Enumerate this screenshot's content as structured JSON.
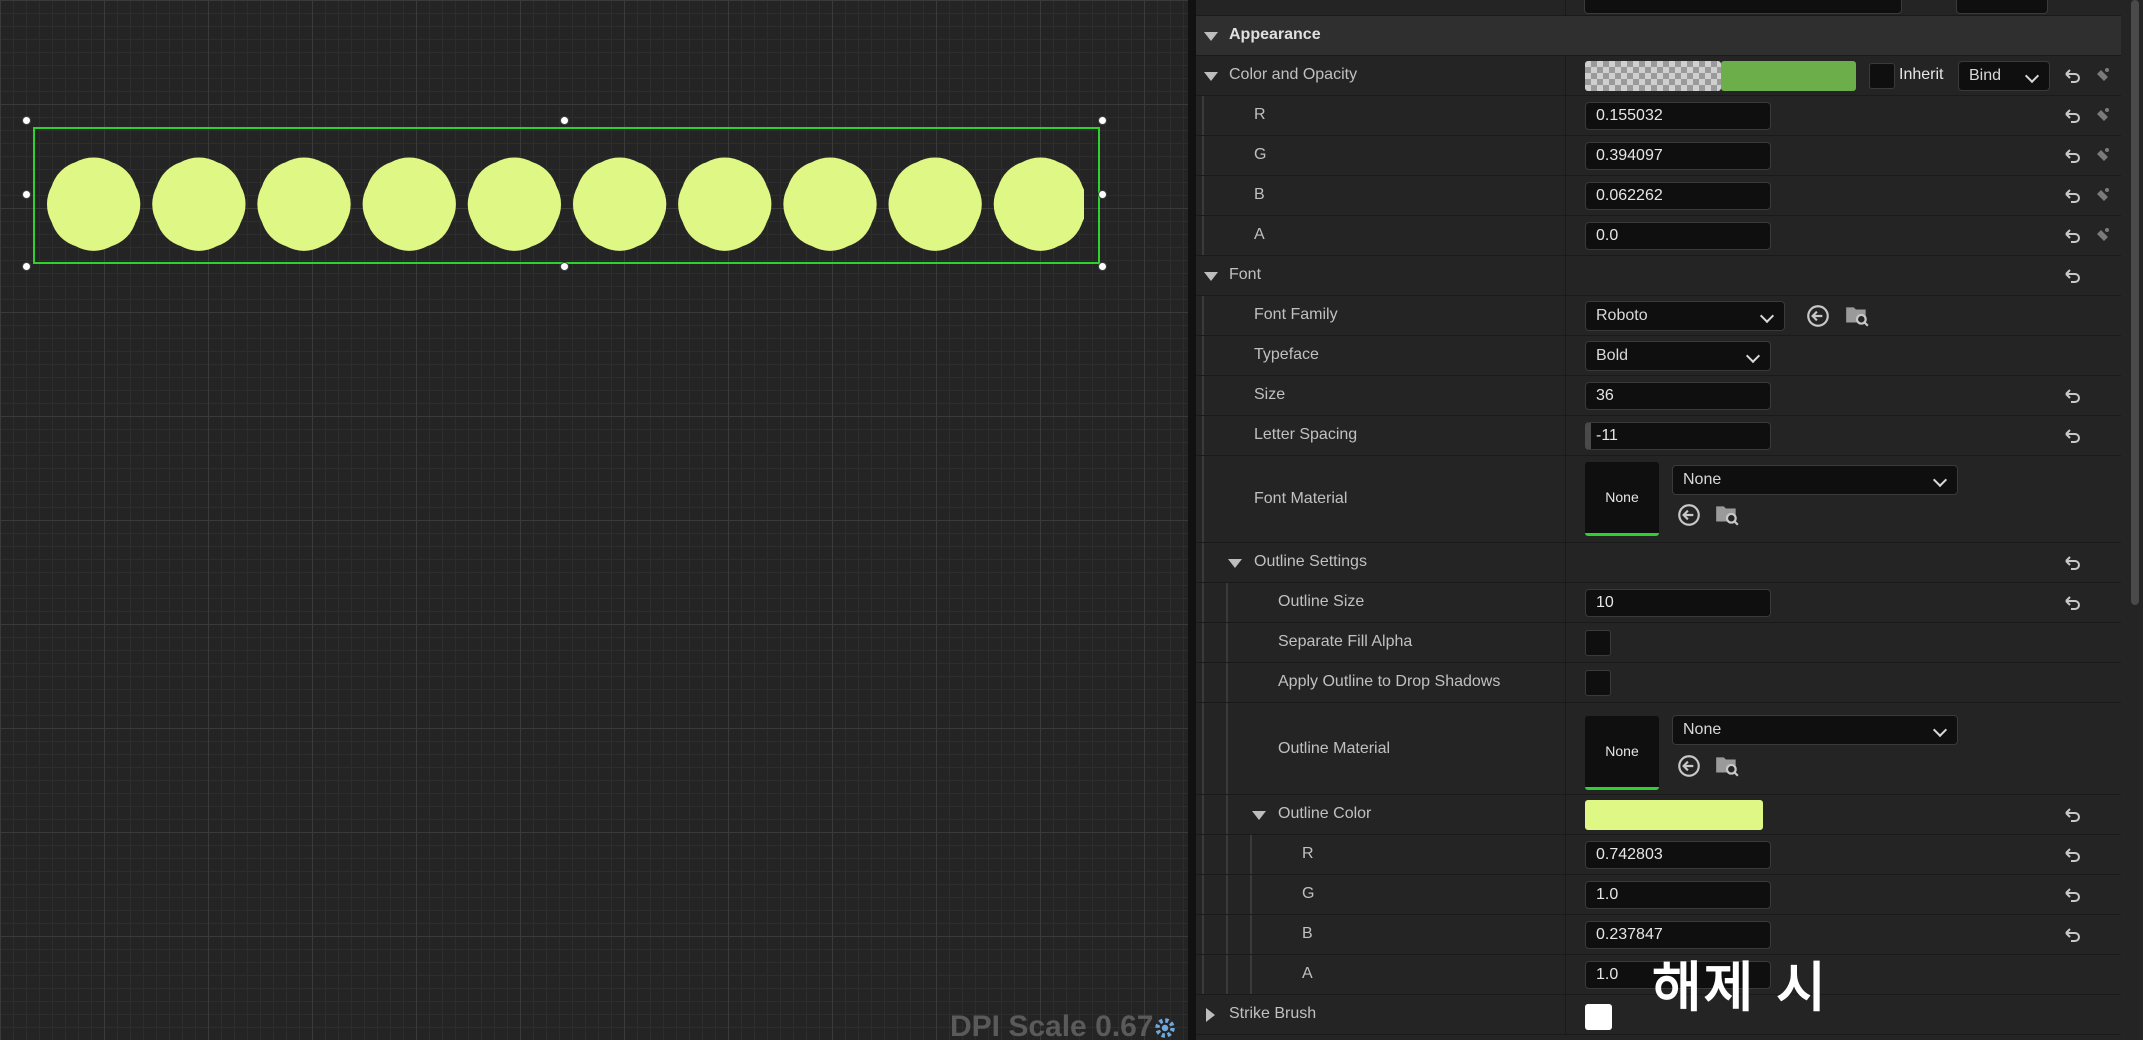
{
  "viewport": {
    "widget_text_color": "#dff784",
    "selection_color": "#2fd12f",
    "dpi_scale_label": "DPI Scale 0.67"
  },
  "details": {
    "appearance": {
      "label": "Appearance"
    },
    "color_and_opacity": {
      "label": "Color and Opacity",
      "swatch_color": "#6cae4a",
      "inherit_label": "Inherit",
      "bind_label": "Bind",
      "components": [
        {
          "label": "R",
          "value": "0.155032"
        },
        {
          "label": "G",
          "value": "0.394097"
        },
        {
          "label": "B",
          "value": "0.062262"
        },
        {
          "label": "A",
          "value": "0.0"
        }
      ]
    },
    "font": {
      "label": "Font",
      "family": {
        "label": "Font Family",
        "value": "Roboto"
      },
      "typeface": {
        "label": "Typeface",
        "value": "Bold"
      },
      "size": {
        "label": "Size",
        "value": "36"
      },
      "letter_spacing": {
        "label": "Letter Spacing",
        "value": "-11"
      },
      "font_material": {
        "label": "Font Material",
        "thumb": "None",
        "value": "None"
      },
      "outline_settings": {
        "label": "Outline Settings",
        "outline_size": {
          "label": "Outline Size",
          "value": "10"
        },
        "separate_fill_alpha": {
          "label": "Separate Fill Alpha"
        },
        "apply_outline_drop_shadows": {
          "label": "Apply Outline to Drop Shadows"
        },
        "outline_material": {
          "label": "Outline Material",
          "thumb": "None",
          "value": "None"
        },
        "outline_color": {
          "label": "Outline Color",
          "swatch_color": "#dff784",
          "components": [
            {
              "label": "R",
              "value": "0.742803"
            },
            {
              "label": "G",
              "value": "1.0"
            },
            {
              "label": "B",
              "value": "0.237847"
            },
            {
              "label": "A",
              "value": "1.0"
            }
          ]
        }
      }
    },
    "strike_brush": {
      "label": "Strike Brush",
      "swatch_color": "#ffffff"
    }
  },
  "subtitle_overlay": "해제 시"
}
